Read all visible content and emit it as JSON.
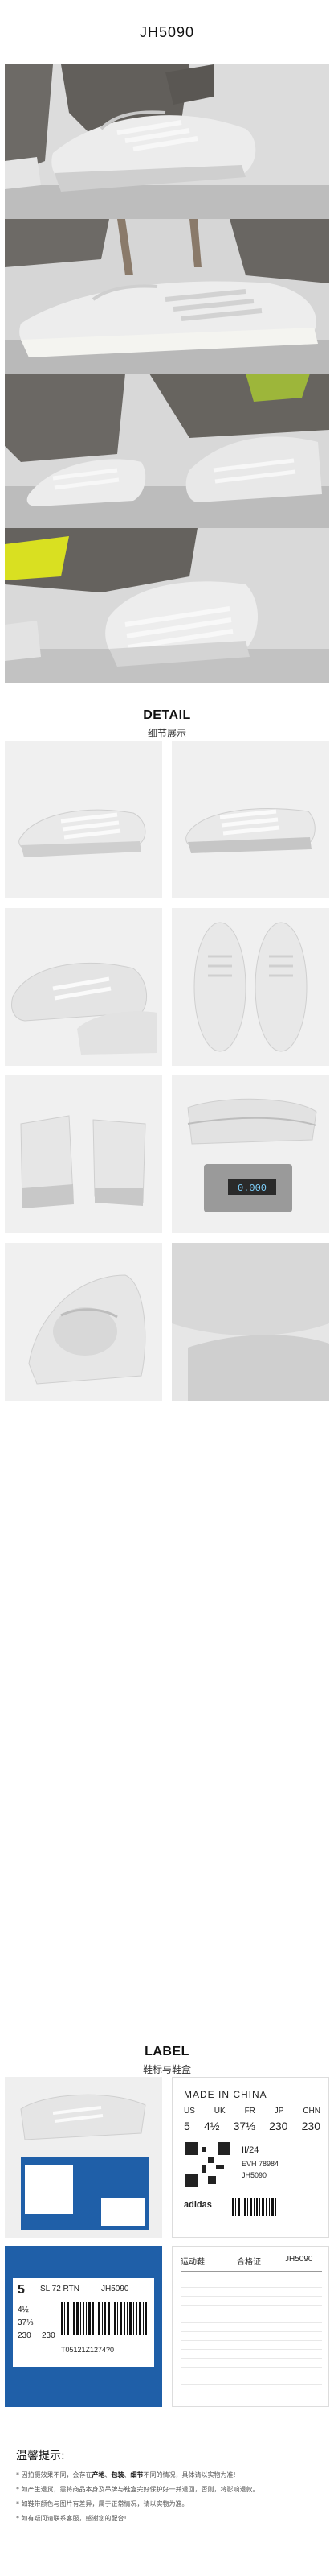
{
  "header": {
    "code": "JH5090"
  },
  "detail": {
    "en": "DETAIL",
    "zh": "细节展示"
  },
  "label_section": {
    "en": "LABEL",
    "zh": "鞋标与鞋盒"
  },
  "label_tag": {
    "made_in": "MADE IN CHINA",
    "size_headers": [
      "US",
      "UK",
      "FR",
      "JP",
      "CHN"
    ],
    "size_values": [
      "5",
      "4½",
      "37⅓",
      "230",
      "230"
    ],
    "date": "II/24",
    "code1": "EVH 78984",
    "code2": "JH5090",
    "brand": "adidas"
  },
  "box_label": {
    "size": "5",
    "uk": "4½",
    "fr": "37⅓",
    "jp": "230",
    "chn": "230",
    "model": "SL 72 RTN",
    "code": "JH5090",
    "barcode_num": "T05121Z1274?0"
  },
  "cert": {
    "title1": "合格证",
    "code": "JH5090",
    "heading": "运动鞋"
  },
  "notes": {
    "title": "温馨提示:",
    "line1_pre": "* 因拍摄效果不同，会存在",
    "line1_em1": "产地",
    "line1_sep1": "、",
    "line1_em2": "包装",
    "line1_sep2": "、",
    "line1_em3": "细节",
    "line1_post": "不同的情况，具体请以实物为准!",
    "line2": "* 如产生退货，需将商品本身及吊牌与鞋盒完好保护好一并退回，否则，将影响退款。",
    "line3": "* 如鞋带颜色与图片有差异，属于正常情况，请以实物为准。",
    "line4": "* 如有疑问请联系客服，感谢您的配合!"
  },
  "colors": {
    "shoe_white": "#ececec",
    "shoe_grey": "#c9c9cb",
    "pants": "#6d6a66",
    "box_blue": "#1f5fa8",
    "accent_yellow": "#d9e021"
  }
}
